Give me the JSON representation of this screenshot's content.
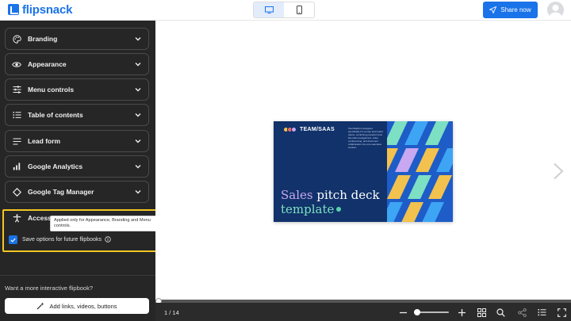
{
  "topbar": {
    "brand": "flipsnack",
    "devices": [
      {
        "name": "desktop",
        "icon": "monitor-icon",
        "active": true
      },
      {
        "name": "mobile",
        "icon": "phone-icon",
        "active": false
      }
    ],
    "share_label": "Share now"
  },
  "sidebar": {
    "panels": [
      {
        "label": "Branding",
        "icon": "palette-icon"
      },
      {
        "label": "Appearance",
        "icon": "eye-icon"
      },
      {
        "label": "Menu controls",
        "icon": "sliders-icon"
      },
      {
        "label": "Table of contents",
        "icon": "list-icon"
      },
      {
        "label": "Lead form",
        "icon": "form-lines-icon"
      },
      {
        "label": "Google Analytics",
        "icon": "bar-chart-icon"
      },
      {
        "label": "Google Tag Manager",
        "icon": "diamond-icon"
      },
      {
        "label": "Accessi",
        "icon": "accessibility-icon"
      }
    ],
    "tooltip": "Applied only for Appearance, Branding and Menu controls.",
    "save_options": {
      "label": "Save options for future flipbooks",
      "checked": true
    },
    "interactive_prompt": "Want a more interactive flipbook?",
    "add_links_label": "Add links, videos, buttons"
  },
  "cover": {
    "brand": "TEAM/SAAS",
    "blurb": "TeamSaaS is designed specifically for remote and hybrid teams, combining powerful tools like task management, video conferencing, and document collaboration into one seamless solution.",
    "title_accent": "Sales",
    "title_rest": " pitch deck",
    "title_line2": "template",
    "colors": {
      "navy": "#11326a",
      "blue": "#1e5cc8",
      "green": "#7ee0c2",
      "yellow": "#f2c14e",
      "purple": "#c8a8f0",
      "sky": "#3da5f4"
    }
  },
  "viewer": {
    "page_indicator": "1 / 14",
    "progress": 0.0,
    "zoom_level": 0.05,
    "tools": [
      "zoom-out-icon",
      "zoom-in-icon",
      "grid-icon",
      "search-icon",
      "share-icon",
      "list-icon",
      "fullscreen-icon"
    ]
  },
  "colors": {
    "accent": "#1a73e8",
    "highlight": "#f3c623",
    "sidebar_bg": "#262626"
  }
}
